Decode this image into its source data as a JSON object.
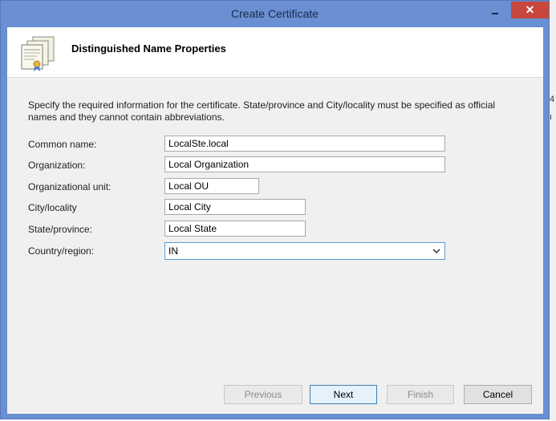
{
  "window": {
    "title": "Create Certificate",
    "close_glyph": "✕"
  },
  "header": {
    "title": "Distinguished Name Properties",
    "icon": "certificate-icon"
  },
  "description": "Specify the required information for the certificate. State/province and City/locality must be specified as official names and they cannot contain abbreviations.",
  "form": {
    "common_name": {
      "label": "Common name:",
      "value": "LocalSte.local"
    },
    "organization": {
      "label": "Organization:",
      "value": "Local Organization"
    },
    "organizational_unit": {
      "label": "Organizational unit:",
      "value": "Local OU"
    },
    "city": {
      "label": "City/locality",
      "value": "Local City"
    },
    "state": {
      "label": "State/province:",
      "value": "Local State"
    },
    "country": {
      "label": "Country/region:",
      "value": "IN"
    }
  },
  "buttons": {
    "previous": "Previous",
    "next": "Next",
    "finish": "Finish",
    "cancel": "Cancel"
  },
  "colors": {
    "titlebar": "#6a8fd3",
    "close_button": "#c7463d",
    "client": "#f0f0f0",
    "focus_border": "#5b9bd5"
  }
}
